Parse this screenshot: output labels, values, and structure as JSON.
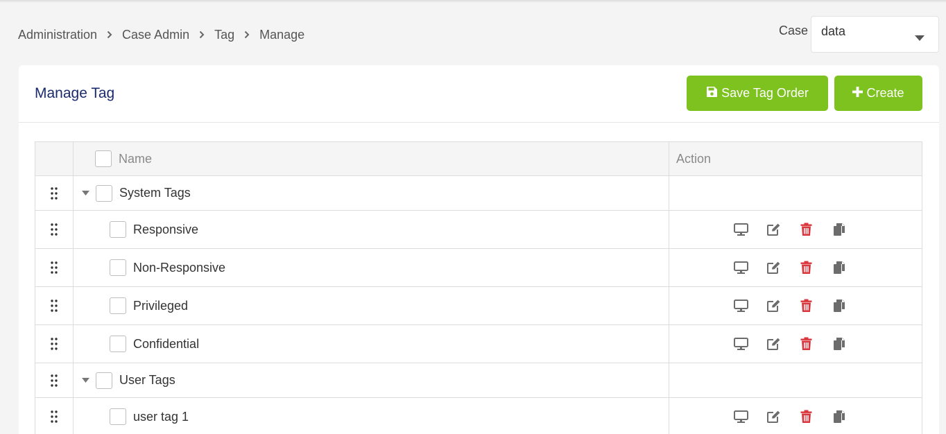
{
  "breadcrumb": {
    "items": [
      "Administration",
      "Case Admin",
      "Tag",
      "Manage"
    ],
    "separator_icon": "chevron-right-icon"
  },
  "case_selector": {
    "label": "Case",
    "value": "data",
    "icon": "caret-down-icon"
  },
  "card": {
    "title": "Manage Tag",
    "save_button": {
      "label": "Save Tag Order",
      "icon": "save-icon"
    },
    "create_button": {
      "label": "Create",
      "icon": "plus-icon"
    }
  },
  "table": {
    "headers": {
      "name": "Name",
      "action": "Action"
    },
    "groups": [
      {
        "label": "System Tags",
        "children": [
          "Responsive",
          "Non-Responsive",
          "Privileged",
          "Confidential"
        ]
      },
      {
        "label": "User Tags",
        "children": [
          "user tag 1"
        ]
      }
    ],
    "action_icons": [
      "view-icon",
      "edit-icon",
      "delete-icon",
      "copy-icon"
    ]
  },
  "colors": {
    "accent_green": "#7dc21f",
    "title_navy": "#1a2a6c",
    "icon_gray": "#6c6c6c",
    "delete_red": "#d9363e"
  }
}
